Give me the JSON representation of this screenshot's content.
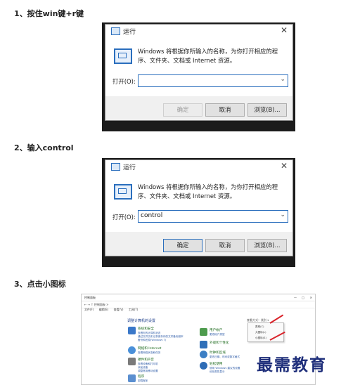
{
  "steps": [
    "1、按住win键+r键",
    "2、输入control",
    "3、点击小图标"
  ],
  "dialog": {
    "title": "运行",
    "close_glyph": "✕",
    "description": "Windows 将根据你所输入的名称，为你打开相应的程序、文件夹、文档或 Internet 资源。",
    "open_label": "打开(O):",
    "ok_label": "确定",
    "cancel_label": "取消",
    "browse_label": "浏览(B)...",
    "dropdown_glyph": "⌄"
  },
  "dialog1": {
    "input_value": ""
  },
  "dialog2": {
    "input_value": "control"
  },
  "control_panel": {
    "window_title": "控制面板",
    "window_buttons": [
      "—",
      "□",
      "✕"
    ],
    "address": "← → ↑ 控制面板 >",
    "menu": [
      "文件(F)",
      "编辑(E)",
      "查看(V)",
      "工具(T)"
    ],
    "heading": "调整计算机的设置",
    "view_by": "查看方式：类别 ▾",
    "popup_options": [
      "类别(C)",
      "大图标(L)",
      "小图标(S)"
    ],
    "items_left": [
      {
        "name": "系统和安全",
        "subs": [
          "查看你的计算机状态",
          "通过文件历史记录保存你的文件备份副本",
          "备份和还原(Windows 7)"
        ]
      },
      {
        "name": "网络和 Internet",
        "subs": [
          "查看网络状态和任务"
        ]
      },
      {
        "name": "硬件和声音",
        "subs": [
          "查看设备和打印机",
          "添加设备",
          "调整常用移动设置"
        ]
      },
      {
        "name": "程序",
        "subs": [
          "卸载程序"
        ]
      }
    ],
    "items_right": [
      {
        "name": "用户帐户",
        "subs": [
          "更改帐户类型"
        ]
      },
      {
        "name": "外观和个性化",
        "subs": []
      },
      {
        "name": "时钟和区域",
        "subs": [
          "更改日期、时间或数字格式"
        ]
      },
      {
        "name": "轻松使用",
        "subs": [
          "使用 Windows 建议的设置",
          "优化视觉显示"
        ]
      }
    ]
  },
  "watermark": "最需教育"
}
